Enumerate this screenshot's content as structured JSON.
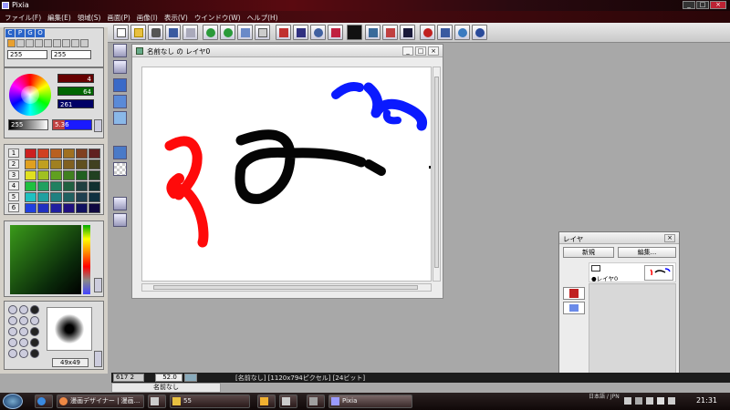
{
  "window": {
    "title": "Pixia"
  },
  "menu": [
    "ファイル(F)",
    "編集(E)",
    "領域(S)",
    "画面(P)",
    "画像(I)",
    "表示(V)",
    "ウインドウ(W)",
    "ヘルプ(H)"
  ],
  "left_panel": {
    "tabs": [
      "C",
      "P",
      "G",
      "O"
    ],
    "num_left": "255",
    "num_right": "255",
    "color_values": [
      "4",
      "64",
      "261"
    ],
    "brightness_left": "255",
    "brightness_right": "5.36",
    "palette_rows": [
      "1",
      "2",
      "3",
      "4",
      "5",
      "6"
    ],
    "palette_colors": [
      "#cc2020",
      "#d04020",
      "#b86020",
      "#a07020",
      "#804020",
      "#602020",
      "#e0a020",
      "#c0a020",
      "#a08020",
      "#806020",
      "#605020",
      "#404020",
      "#e0e020",
      "#a0c020",
      "#60a020",
      "#408020",
      "#206020",
      "#204020",
      "#20c040",
      "#20a060",
      "#208060",
      "#206040",
      "#204040",
      "#103030",
      "#20c0c0",
      "#20a0a0",
      "#208080",
      "#206060",
      "#204050",
      "#103040",
      "#2040e0",
      "#2030c0",
      "#2020a0",
      "#201080",
      "#101060",
      "#100840"
    ],
    "brush_size": "49x49"
  },
  "canvas_window": {
    "title": "名前なし の レイヤ0",
    "min_label": "_",
    "max_label": "□",
    "close_label": "×"
  },
  "layer_panel": {
    "title": "レイヤ",
    "close_label": "×",
    "new_button": "新規",
    "edit_button": "編集...",
    "layer_name": "●レイヤ0"
  },
  "statusbar": {
    "coords": "617 2",
    "zoom": "52.0",
    "info": "[名前なし] [1120x794ピクセル] [24ビット]",
    "doc_tab": "名前なし"
  },
  "taskbar": {
    "items": [
      {
        "label": "漫画デザイナー | 漫画..."
      },
      {
        "label": ""
      },
      {
        "label": "55"
      },
      {
        "label": ""
      },
      {
        "label": ""
      },
      {
        "label": "Pixia"
      }
    ],
    "clock": "21:31",
    "lang": "日本語 / JPN"
  },
  "colors": {
    "accent": "#2a64c8",
    "title_red": "#5a0a10",
    "stroke_red": "#ff0a0a",
    "stroke_black": "#050505",
    "stroke_blue": "#0a1aff"
  }
}
